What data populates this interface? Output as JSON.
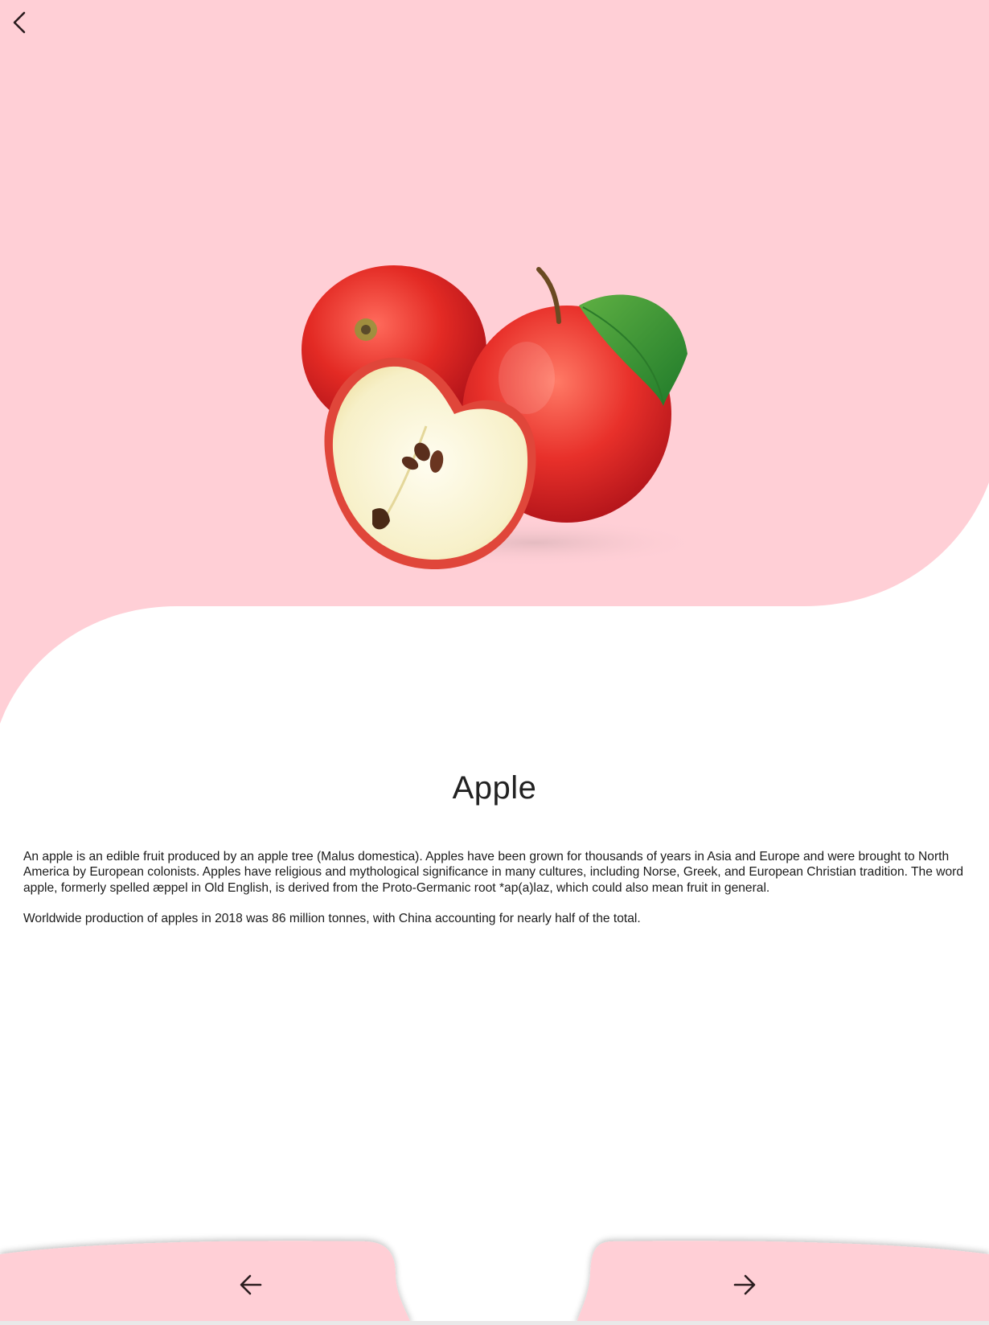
{
  "colors": {
    "accent_pink": "#ffcfd6",
    "text_dark": "#1a1a1a",
    "icon_dark": "#2b1d1f"
  },
  "header": {
    "back_icon": "chevron-left-icon"
  },
  "hero": {
    "image_subject": "apples-icon"
  },
  "fruit": {
    "name": "Apple",
    "paragraphs": [
      "An apple is an edible fruit produced by an apple tree (Malus domestica). Apples have been grown for thousands of years in Asia and Europe and were brought to North America by European colonists. Apples have religious and mythological significance in many cultures, including Norse, Greek, and European Christian tradition. The word apple, formerly spelled æppel in Old English, is derived from the Proto-Germanic root *ap(a)laz, which could also mean fruit in general.",
      "Worldwide production of apples in 2018 was 86 million tonnes, with China accounting for nearly half of the total."
    ]
  },
  "navigation": {
    "prev_icon": "arrow-left-icon",
    "next_icon": "arrow-right-icon"
  }
}
